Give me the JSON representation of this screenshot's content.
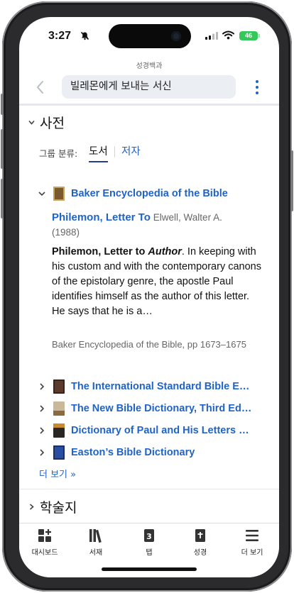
{
  "status_bar": {
    "time": "3:27",
    "battery": "46"
  },
  "header": {
    "subtitle": "성경백과",
    "search_text": "빌레몬에게 보내는 서신"
  },
  "dictionary_section": {
    "title": "사전",
    "group_label": "그룹 분류:",
    "tabs": [
      {
        "label": "도서",
        "active": true
      },
      {
        "label": "저자",
        "active": false
      }
    ],
    "books": [
      {
        "title": "Baker Encyclopedia of the Bible",
        "expanded": true,
        "cover_color": "#7a5a2c"
      },
      {
        "title": "The International Standard Bible E…",
        "expanded": false,
        "cover_color": "#5b3a2e"
      },
      {
        "title": "The New Bible Dictionary, Third Ed…",
        "expanded": false,
        "cover_color": "#c9b89a"
      },
      {
        "title": "Dictionary of Paul and His Letters …",
        "expanded": false,
        "cover_color": "#2a2622"
      },
      {
        "title": "Easton’s Bible Dictionary",
        "expanded": false,
        "cover_color": "#2b4fa0"
      }
    ],
    "article": {
      "link": "Philemon, Letter To",
      "author": "Elwell, Walter A.",
      "year": "(1988)",
      "snippet_bold": "Philemon, Letter to",
      "snippet_bold_italic": "Author",
      "snippet_text": ". In keeping with his custom and with the contemporary canons of the epistolary genre, the apostle Paul identifies himself as the author of this letter. He says that he is a…",
      "source": "Baker Encyclopedia of the Bible, pp 1673–1675"
    },
    "more_label": "더 보기 »"
  },
  "journals_section": {
    "title": "학술지"
  },
  "tab_bar": {
    "items": [
      {
        "label": "대시보드",
        "icon": "dashboard-icon"
      },
      {
        "label": "서재",
        "icon": "library-icon"
      },
      {
        "label": "탭",
        "icon": "tabs-icon",
        "badge": "3"
      },
      {
        "label": "성경",
        "icon": "bible-icon"
      },
      {
        "label": "더 보기",
        "icon": "menu-icon"
      }
    ]
  }
}
